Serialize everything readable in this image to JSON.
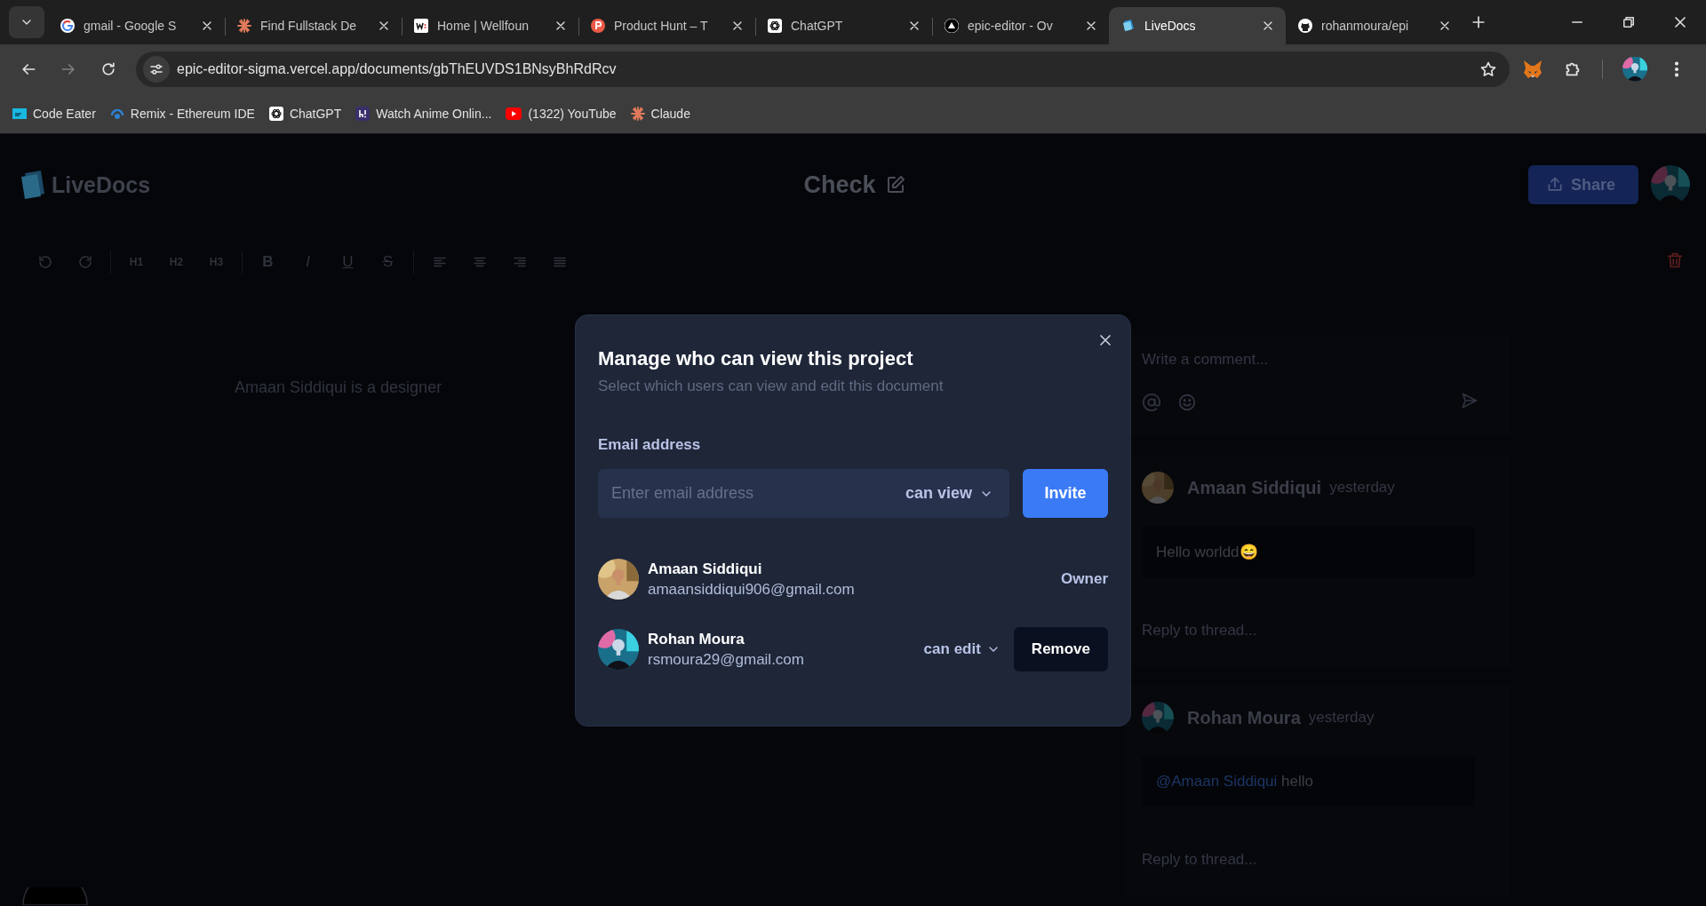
{
  "browser": {
    "tabs": [
      {
        "title": "gmail - Google S",
        "selected": false
      },
      {
        "title": "Find Fullstack De",
        "selected": false
      },
      {
        "title": "Home | Wellfoun",
        "selected": false
      },
      {
        "title": "Product Hunt – T",
        "selected": false
      },
      {
        "title": "ChatGPT",
        "selected": false
      },
      {
        "title": "epic-editor - Ov",
        "selected": false
      },
      {
        "title": "LiveDocs",
        "selected": true
      },
      {
        "title": "rohanmoura/epi",
        "selected": false
      }
    ],
    "forward_disabled": true,
    "url": "epic-editor-sigma.vercel.app/documents/gbThEUVDS1BNsyBhRdRcv",
    "bookmarks": [
      "Code Eater",
      "Remix - Ethereum IDE",
      "ChatGPT",
      "Watch Anime Onlin...",
      "(1322) YouTube",
      "Claude"
    ]
  },
  "app": {
    "logo": "LiveDocs",
    "document_title": "Check",
    "share_button": "Share",
    "toolbar": {
      "headings": [
        "H1",
        "H2",
        "H3"
      ],
      "marks": [
        "B",
        "I",
        "U",
        "S"
      ]
    },
    "content": "Amaan Siddiqui is a designer",
    "comments": {
      "composer": {
        "placeholder": "Write a comment..."
      },
      "threads": [
        {
          "author": "Amaan Siddiqui",
          "time": "yesterday",
          "body": "Hello worldd😄",
          "reply": {
            "placeholder": "Reply to thread..."
          }
        },
        {
          "author": "Rohan Moura",
          "time": "yesterday",
          "mention": "@Amaan Siddiqui",
          "body": "hello",
          "reply": {
            "placeholder": "Reply to thread..."
          }
        }
      ]
    }
  },
  "share_dialog": {
    "title": "Manage who can view this project",
    "subtitle": "Select which users can view and edit this document",
    "email_label": "Email address",
    "email_field": {
      "placeholder": "Enter email address"
    },
    "permission": "can view",
    "invite_button": "Invite",
    "users": [
      {
        "kind": "owner",
        "name": "Amaan Siddiqui",
        "email": "amaansiddiqui906@gmail.com",
        "role": "Owner"
      },
      {
        "kind": "collaborator",
        "name": "Rohan Moura",
        "email": "rsmoura29@gmail.com",
        "permission": "can edit",
        "button": "Remove"
      }
    ]
  }
}
